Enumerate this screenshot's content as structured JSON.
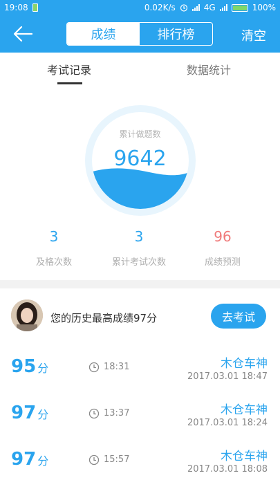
{
  "status_bar": {
    "time": "19:08",
    "net_speed": "0.02K/s",
    "network": "4G",
    "battery": "100%"
  },
  "header": {
    "back_icon": "arrow-left-icon",
    "segments": [
      "成绩",
      "排行榜"
    ],
    "active_segment": 0,
    "right_action": "清空"
  },
  "tabs": [
    "考试记录",
    "数据统计"
  ],
  "gauge": {
    "label": "累计做题数",
    "value": "9642"
  },
  "stats": [
    {
      "value": "3",
      "label": "及格次数"
    },
    {
      "value": "3",
      "label": "累计考试次数"
    },
    {
      "value": "96",
      "label": "成绩预测"
    }
  ],
  "best": {
    "text": "您的历史最高成绩97分",
    "button": "去考试"
  },
  "records": [
    {
      "score": "95",
      "unit": "分",
      "duration": "18:31",
      "name": "木仓车神",
      "date": "2017.03.01  18:47"
    },
    {
      "score": "97",
      "unit": "分",
      "duration": "13:37",
      "name": "木仓车神",
      "date": "2017.03.01  18:24"
    },
    {
      "score": "97",
      "unit": "分",
      "duration": "15:57",
      "name": "木仓车神",
      "date": "2017.03.01  18:08"
    }
  ],
  "colors": {
    "primary": "#2aa4ee",
    "accent_red": "#f07a7a"
  }
}
